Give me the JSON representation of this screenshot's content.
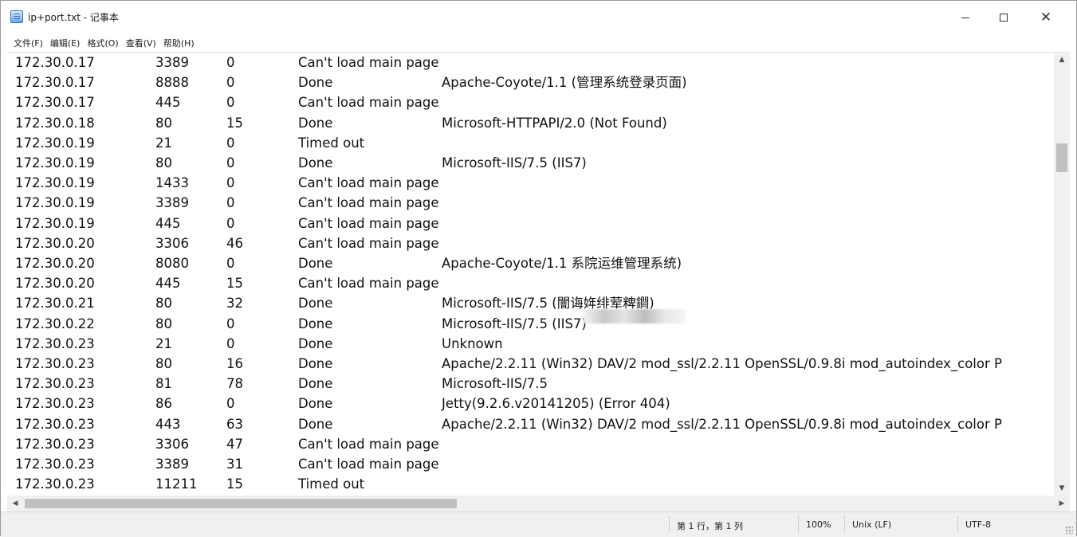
{
  "window": {
    "title": "ip+port.txt - 记事本",
    "controls": {
      "minimize": "—",
      "maximize": "□",
      "close": "✕"
    }
  },
  "menu": [
    "文件(F)",
    "编辑(E)",
    "格式(O)",
    "查看(V)",
    "帮助(H)"
  ],
  "rows": [
    {
      "ip": "172.30.0.17",
      "port": "3389",
      "time": "0",
      "status": "Can't load main page",
      "banner": ""
    },
    {
      "ip": "172.30.0.17",
      "port": "8888",
      "time": "0",
      "status": "Done",
      "banner": "Apache-Coyote/1.1 (管理系统登录页面)"
    },
    {
      "ip": "172.30.0.17",
      "port": "445",
      "time": "0",
      "status": "Can't load main page",
      "banner": ""
    },
    {
      "ip": "172.30.0.18",
      "port": "80",
      "time": "15",
      "status": "Done",
      "banner": "Microsoft-HTTPAPI/2.0 (Not Found)"
    },
    {
      "ip": "172.30.0.19",
      "port": "21",
      "time": "0",
      "status": "Timed out",
      "banner": ""
    },
    {
      "ip": "172.30.0.19",
      "port": "80",
      "time": "0",
      "status": "Done",
      "banner": "Microsoft-IIS/7.5 (IIS7)"
    },
    {
      "ip": "172.30.0.19",
      "port": "1433",
      "time": "0",
      "status": "Can't load main page",
      "banner": ""
    },
    {
      "ip": "172.30.0.19",
      "port": "3389",
      "time": "0",
      "status": "Can't load main page",
      "banner": ""
    },
    {
      "ip": "172.30.0.19",
      "port": "445",
      "time": "0",
      "status": "Can't load main page",
      "banner": ""
    },
    {
      "ip": "172.30.0.20",
      "port": "3306",
      "time": "46",
      "status": "Can't load main page",
      "banner": ""
    },
    {
      "ip": "172.30.0.20",
      "port": "8080",
      "time": "0",
      "status": "Done",
      "banner": "Apache-Coyote/1.1                              系院运维管理系统)"
    },
    {
      "ip": "172.30.0.20",
      "port": "445",
      "time": "15",
      "status": "Can't load main page",
      "banner": ""
    },
    {
      "ip": "172.30.0.21",
      "port": "80",
      "time": "32",
      "status": "Done",
      "banner": "Microsoft-IIS/7.5 (闇诲姩绯荤粺鐧)"
    },
    {
      "ip": "172.30.0.22",
      "port": "80",
      "time": "0",
      "status": "Done",
      "banner": "Microsoft-IIS/7.5 (IIS7)"
    },
    {
      "ip": "172.30.0.23",
      "port": "21",
      "time": "0",
      "status": "Done",
      "banner": "Unknown"
    },
    {
      "ip": "172.30.0.23",
      "port": "80",
      "time": "16",
      "status": "Done",
      "banner": "Apache/2.2.11 (Win32) DAV/2 mod_ssl/2.2.11 OpenSSL/0.9.8i mod_autoindex_color P"
    },
    {
      "ip": "172.30.0.23",
      "port": "81",
      "time": "78",
      "status": "Done",
      "banner": "Microsoft-IIS/7.5"
    },
    {
      "ip": "172.30.0.23",
      "port": "86",
      "time": "0",
      "status": "Done",
      "banner": "Jetty(9.2.6.v20141205) (Error 404)"
    },
    {
      "ip": "172.30.0.23",
      "port": "443",
      "time": "63",
      "status": "Done",
      "banner": "Apache/2.2.11 (Win32) DAV/2 mod_ssl/2.2.11 OpenSSL/0.9.8i mod_autoindex_color P"
    },
    {
      "ip": "172.30.0.23",
      "port": "3306",
      "time": "47",
      "status": "Can't load main page",
      "banner": ""
    },
    {
      "ip": "172.30.0.23",
      "port": "3389",
      "time": "31",
      "status": "Can't load main page",
      "banner": ""
    },
    {
      "ip": "172.30.0.23",
      "port": "11211",
      "time": "15",
      "status": "Timed out",
      "banner": ""
    }
  ],
  "statusbar": {
    "position": "第 1 行，第 1 列",
    "zoom": "100%",
    "line_ending": "Unix (LF)",
    "encoding": "UTF-8"
  },
  "scroll": {
    "vertical": {
      "up_arrow": "▲",
      "down_arrow": "▼"
    },
    "horizontal": {
      "left_arrow": "◀",
      "right_arrow": "▶"
    }
  }
}
